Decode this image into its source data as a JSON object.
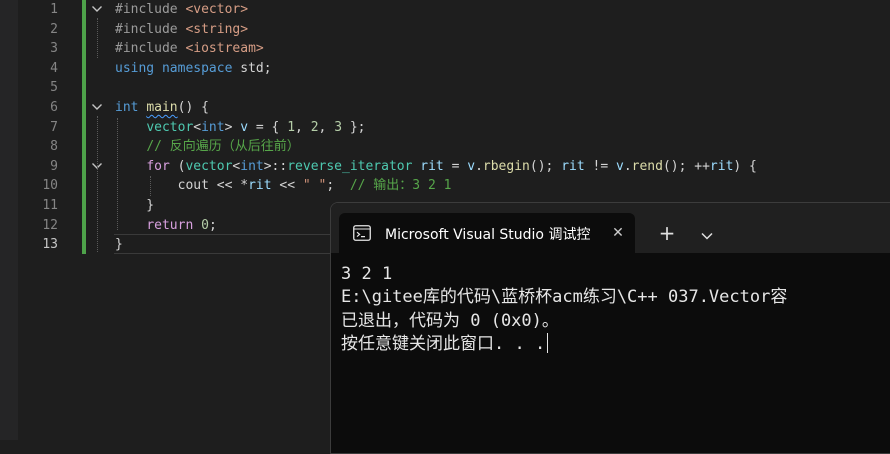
{
  "editor": {
    "line_numbers": [
      "1",
      "2",
      "3",
      "4",
      "5",
      "6",
      "7",
      "8",
      "9",
      "10",
      "11",
      "12",
      "13"
    ],
    "active_line": "13",
    "lines": [
      [
        {
          "t": "#include ",
          "c": "pp"
        },
        {
          "t": "<vector>",
          "c": "inc"
        }
      ],
      [
        {
          "t": "#include ",
          "c": "pp"
        },
        {
          "t": "<string>",
          "c": "inc"
        }
      ],
      [
        {
          "t": "#include ",
          "c": "pp"
        },
        {
          "t": "<iostream>",
          "c": "inc"
        }
      ],
      [
        {
          "t": "using",
          "c": "k"
        },
        {
          "t": " ",
          "c": ""
        },
        {
          "t": "namespace",
          "c": "k"
        },
        {
          "t": " std;",
          "c": ""
        }
      ],
      [],
      [
        {
          "t": "int",
          "c": "k"
        },
        {
          "t": " ",
          "c": ""
        },
        {
          "t": "main",
          "c": "fn squig"
        },
        {
          "t": "() {",
          "c": ""
        }
      ],
      [
        {
          "t": "    ",
          "c": ""
        },
        {
          "t": "vector",
          "c": "ty"
        },
        {
          "t": "<",
          "c": ""
        },
        {
          "t": "int",
          "c": "k"
        },
        {
          "t": "> ",
          "c": ""
        },
        {
          "t": "v",
          "c": "var"
        },
        {
          "t": " = { ",
          "c": ""
        },
        {
          "t": "1",
          "c": "num"
        },
        {
          "t": ", ",
          "c": ""
        },
        {
          "t": "2",
          "c": "num"
        },
        {
          "t": ", ",
          "c": ""
        },
        {
          "t": "3",
          "c": "num"
        },
        {
          "t": " };",
          "c": ""
        }
      ],
      [
        {
          "t": "    ",
          "c": ""
        },
        {
          "t": "// 反向遍历（从后往前）",
          "c": "cm"
        }
      ],
      [
        {
          "t": "    ",
          "c": ""
        },
        {
          "t": "for",
          "c": "kw2"
        },
        {
          "t": " (",
          "c": ""
        },
        {
          "t": "vector",
          "c": "ty"
        },
        {
          "t": "<",
          "c": ""
        },
        {
          "t": "int",
          "c": "k"
        },
        {
          "t": ">::",
          "c": ""
        },
        {
          "t": "reverse_iterator",
          "c": "ty"
        },
        {
          "t": " ",
          "c": ""
        },
        {
          "t": "rit",
          "c": "var"
        },
        {
          "t": " = ",
          "c": ""
        },
        {
          "t": "v",
          "c": "var"
        },
        {
          "t": ".",
          "c": ""
        },
        {
          "t": "rbegin",
          "c": "fn"
        },
        {
          "t": "(); ",
          "c": ""
        },
        {
          "t": "rit",
          "c": "var"
        },
        {
          "t": " != ",
          "c": ""
        },
        {
          "t": "v",
          "c": "var"
        },
        {
          "t": ".",
          "c": ""
        },
        {
          "t": "rend",
          "c": "fn"
        },
        {
          "t": "(); ++",
          "c": ""
        },
        {
          "t": "rit",
          "c": "var"
        },
        {
          "t": ") {",
          "c": ""
        }
      ],
      [
        {
          "t": "        cout << *",
          "c": ""
        },
        {
          "t": "rit",
          "c": "var"
        },
        {
          "t": " << ",
          "c": ""
        },
        {
          "t": "\" \"",
          "c": "str"
        },
        {
          "t": ";  ",
          "c": ""
        },
        {
          "t": "// 输出：3 2 1",
          "c": "cm"
        }
      ],
      [
        {
          "t": "    }",
          "c": ""
        }
      ],
      [
        {
          "t": "    ",
          "c": ""
        },
        {
          "t": "return",
          "c": "kw2"
        },
        {
          "t": " ",
          "c": ""
        },
        {
          "t": "0",
          "c": "num"
        },
        {
          "t": ";",
          "c": ""
        }
      ],
      [
        {
          "t": "}",
          "c": ""
        }
      ]
    ]
  },
  "terminal": {
    "tab_title": "Microsoft Visual Studio 调试控",
    "close_glyph": "✕",
    "new_tab_glyph": "+",
    "output": [
      "3 2 1",
      "E:\\gitee库的代码\\蓝桥杯acm练习\\C++ 037.Vector容",
      "已退出，代码为 0 (0x0)。",
      "按任意键关闭此窗口. . ."
    ]
  },
  "icons": {
    "fold": "chevron-down-icon",
    "terminal": "terminal-icon",
    "dropdown": "chevron-down-icon"
  }
}
